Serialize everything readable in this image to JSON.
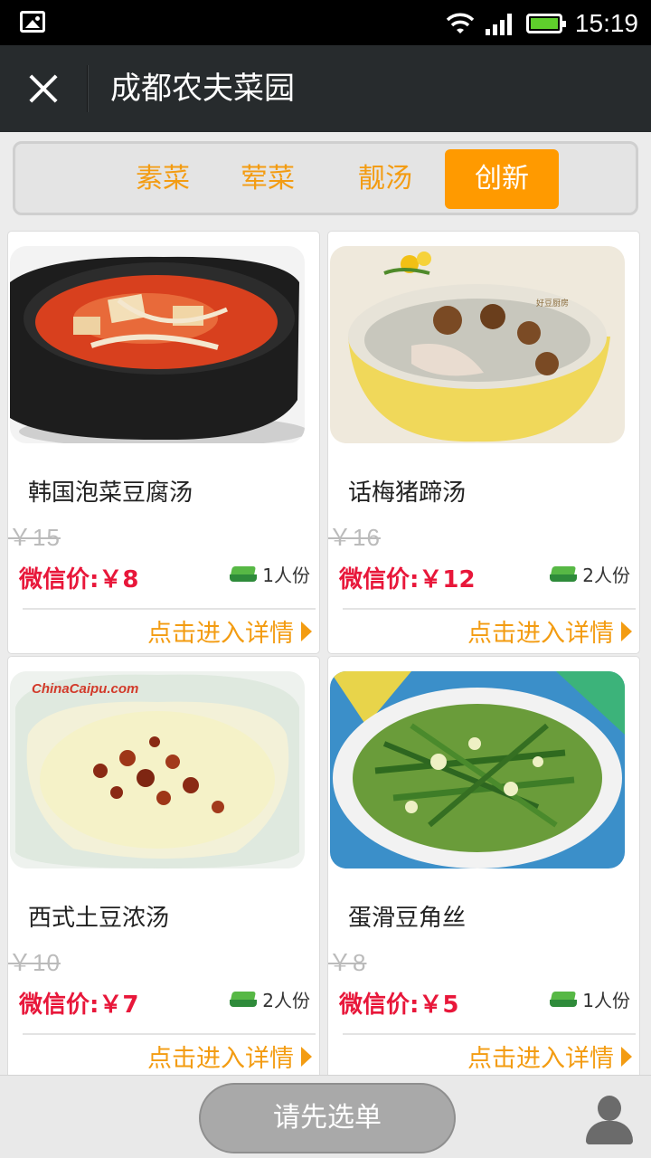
{
  "status_bar": {
    "time": "15:19"
  },
  "header": {
    "title": "成都农夫菜园"
  },
  "tabs": [
    {
      "label": "素菜",
      "active": false
    },
    {
      "label": "荤菜",
      "active": false
    },
    {
      "label": "靓汤",
      "active": false
    },
    {
      "label": "创新",
      "active": true
    }
  ],
  "dishes": [
    {
      "name": "韩国泡菜豆腐汤",
      "old_price": "￥15",
      "wx_price": "微信价:￥8",
      "serving": "1人份",
      "detail": "点击进入详情"
    },
    {
      "name": "话梅猪蹄汤",
      "old_price": "￥16",
      "wx_price": "微信价:￥12",
      "serving": "2人份",
      "detail": "点击进入详情"
    },
    {
      "name": "西式土豆浓汤",
      "old_price": "￥10",
      "wx_price": "微信价:￥7",
      "serving": "2人份",
      "detail": "点击进入详情"
    },
    {
      "name": "蛋滑豆角丝",
      "old_price": "￥8",
      "wx_price": "微信价:￥5",
      "serving": "1人份",
      "detail": "点击进入详情"
    }
  ],
  "images": {
    "watermark": "ChinaCaipu.com"
  },
  "bottom": {
    "select_label": "请先选单"
  },
  "colors": {
    "accent": "#ff9a00",
    "price": "#e8173a",
    "header_bg": "#272b2d"
  }
}
